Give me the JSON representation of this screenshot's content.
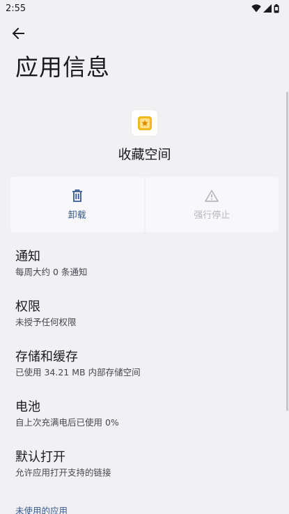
{
  "status_bar": {
    "time": "2:55",
    "icons": [
      "wifi-icon",
      "signal-icon",
      "battery-icon"
    ]
  },
  "header": {
    "back_icon": "arrow-back-icon",
    "title": "应用信息"
  },
  "app": {
    "name": "收藏空间",
    "icon": "app-icon"
  },
  "actions": [
    {
      "label": "卸载",
      "icon": "trash-icon",
      "enabled": true
    },
    {
      "label": "强行停止",
      "icon": "warning-icon",
      "enabled": false
    }
  ],
  "settings": [
    {
      "title": "通知",
      "summary": "每周大约 0 条通知"
    },
    {
      "title": "权限",
      "summary": "未授予任何权限"
    },
    {
      "title": "存储和缓存",
      "summary": "已使用 34.21 MB 内部存储空间"
    },
    {
      "title": "电池",
      "summary": "自上次充满电后已使用 0%"
    },
    {
      "title": "默认打开",
      "summary": "允许应用打开支持的链接"
    }
  ],
  "section": {
    "unused_apps_header": "未使用的应用"
  },
  "colors": {
    "background": "#f1f1f4",
    "accent": "#36598f",
    "disabled": "#b7b8bd",
    "app_icon": "#f4b71a"
  }
}
